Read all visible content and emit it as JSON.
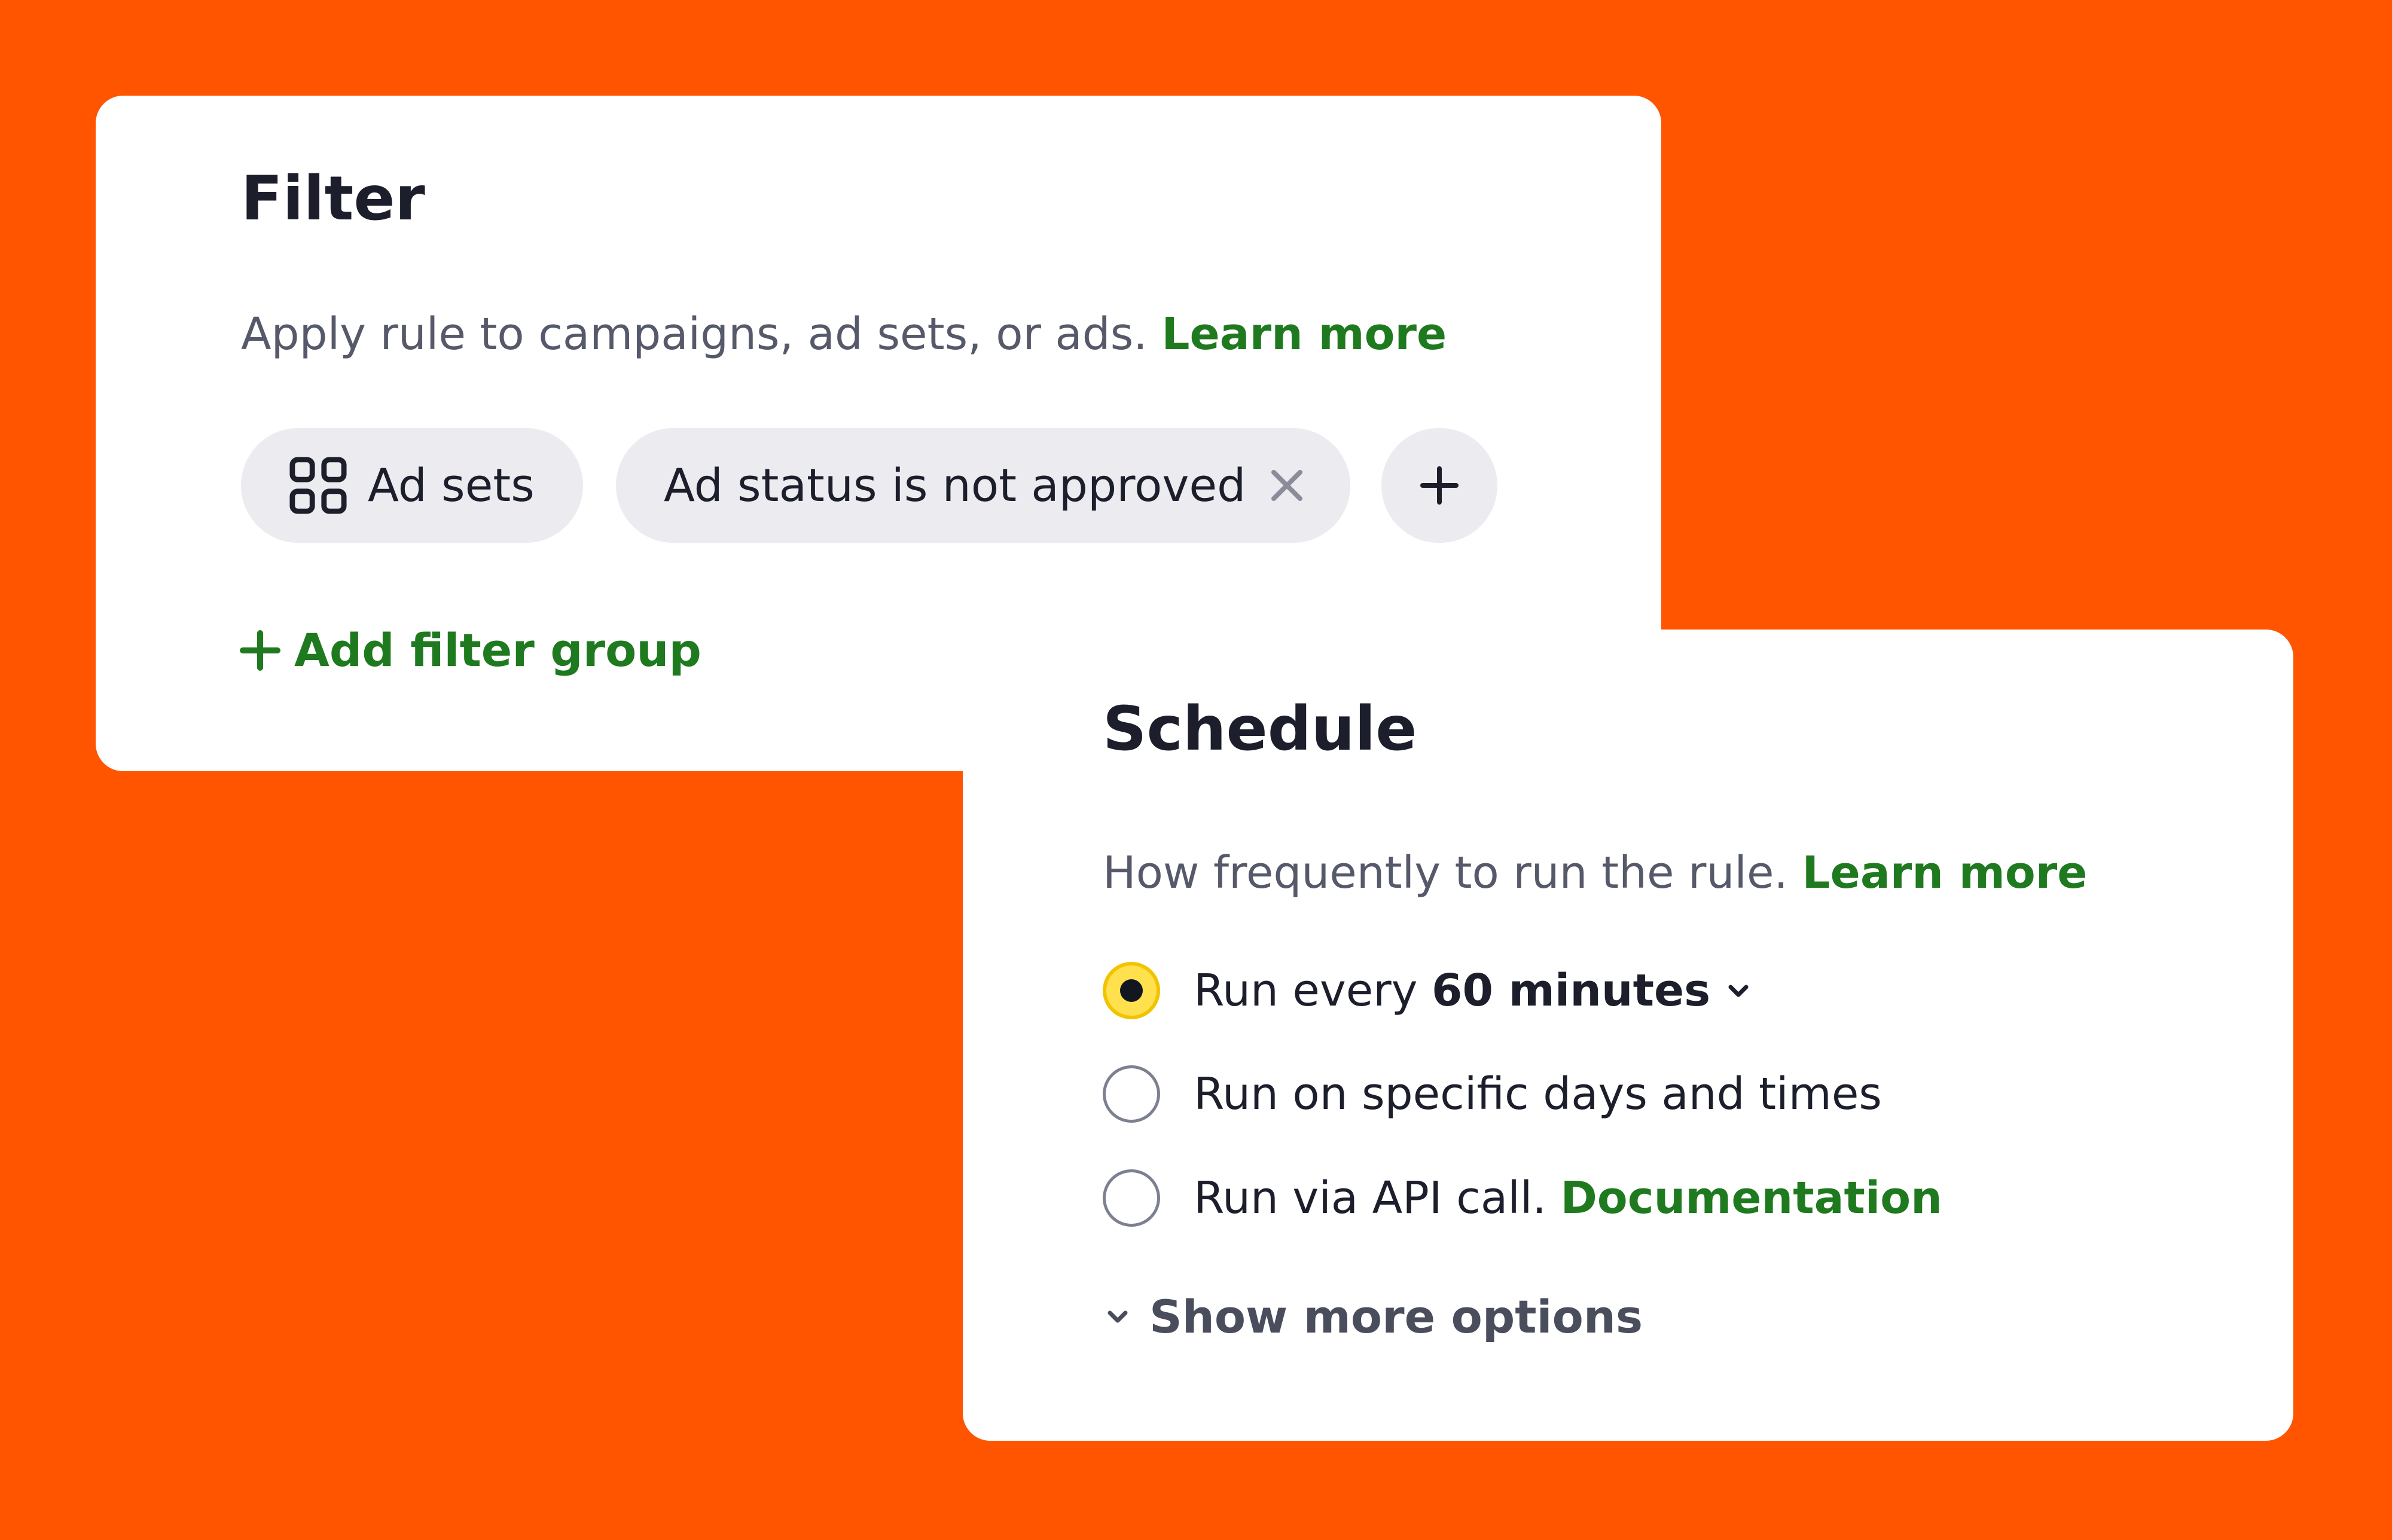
{
  "colors": {
    "background": "#FF5501",
    "card": "#ffffff",
    "link_green": "#1f7a1f",
    "chip_bg": "#ebebf0",
    "radio_selected": "#ffe14d"
  },
  "filter": {
    "title": "Filter",
    "description": "Apply rule to campaigns, ad sets, or ads.",
    "learn_more": "Learn more",
    "chips": {
      "level_label": "Ad sets",
      "level_icon": "grid-icon",
      "condition_label": "Ad status is not approved",
      "condition_remove_icon": "close-icon",
      "add_icon": "plus-icon"
    },
    "add_group_label": "Add filter group",
    "add_group_icon": "plus-icon"
  },
  "schedule": {
    "title": "Schedule",
    "description": "How frequently to run the rule.",
    "learn_more": "Learn more",
    "options": [
      {
        "label_prefix": "Run every",
        "interval": "60 minutes",
        "selected": true,
        "dropdown_icon": "chevron-down-icon"
      },
      {
        "label": "Run on specific days and times",
        "selected": false
      },
      {
        "label": "Run via API call.",
        "link": "Documentation",
        "selected": false
      }
    ],
    "show_more_label": "Show more options",
    "show_more_icon": "chevron-down-icon"
  }
}
